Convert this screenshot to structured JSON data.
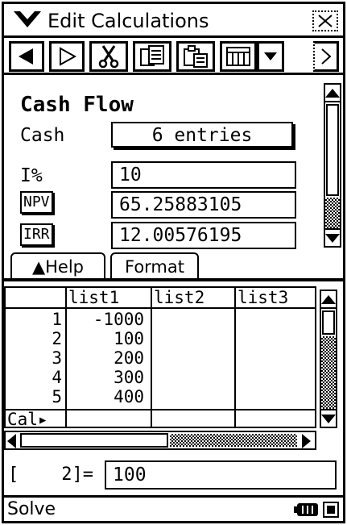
{
  "menubar": {
    "menu_label": "Edit Calculations",
    "menu_icon": "chevron-down-icon"
  },
  "toolbar": {
    "buttons": [
      {
        "name": "back-arrow",
        "glyph": "◀"
      },
      {
        "name": "forward-arrow",
        "glyph": "▷"
      },
      {
        "name": "cut",
        "glyph": "✂"
      },
      {
        "name": "copy",
        "glyph": "⧉"
      },
      {
        "name": "paste",
        "glyph": "⎘"
      },
      {
        "name": "grid",
        "glyph": "▦"
      },
      {
        "name": "dropdown",
        "glyph": "▼"
      },
      {
        "name": "more",
        "glyph": "▷"
      }
    ]
  },
  "panel": {
    "title": "Cash Flow",
    "cash_label": "Cash",
    "cash_button": "6 entries",
    "rate_label": "I%",
    "rate_value": "10",
    "npv_label": "NPV",
    "npv_value": "65.25883105",
    "irr_label": "IRR",
    "irr_value": "12.00576195"
  },
  "tabs": {
    "help": "▲Help",
    "format": "Format"
  },
  "sheet": {
    "columns": [
      "list1",
      "list2",
      "list3"
    ],
    "row_numbers": [
      "1",
      "2",
      "3",
      "4",
      "5"
    ],
    "list1": [
      "-1000",
      "100",
      "200",
      "300",
      "400"
    ],
    "cal_label": "Cal▸"
  },
  "entry": {
    "cell_ref": "[    2]=",
    "value": "100"
  },
  "status": {
    "text": "Solve"
  }
}
